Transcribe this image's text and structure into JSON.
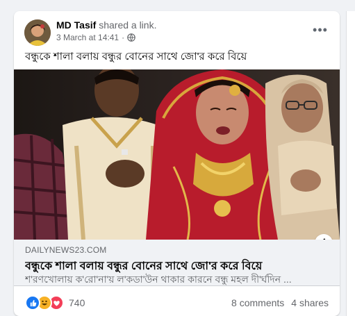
{
  "post": {
    "author": "MD Tasif",
    "action": "shared a link.",
    "timestamp": "3 March at 14:41",
    "separator": "·",
    "privacy_icon": "globe-icon",
    "more_icon": "more-options-icon",
    "more_label": "•••",
    "caption": "বন্ধুকে শালা বলায় বন্ধুর বোনের সাথে জো'র করে বিয়ে"
  },
  "link": {
    "domain": "DAILYNEWS23.COM",
    "title": "বন্ধুকে শালা বলায় বন্ধুর বোনের সাথে জো'র করে বিয়ে",
    "description": "শ'রণখোলায় ক'রো'না'য় ল'কডা'উন থাকার কারনে বন্ধু মহল দী'র্ঘদিন ...",
    "info_label": "i"
  },
  "stats": {
    "reactions": [
      "like",
      "haha",
      "love"
    ],
    "reaction_count": "740",
    "comments": "8 comments",
    "shares": "4 shares"
  },
  "colors": {
    "background": "#f0f2f5",
    "card": "#ffffff",
    "secondary_text": "#65676b",
    "like": "#1877f2",
    "haha": "#f7b125",
    "love": "#f33e58"
  }
}
